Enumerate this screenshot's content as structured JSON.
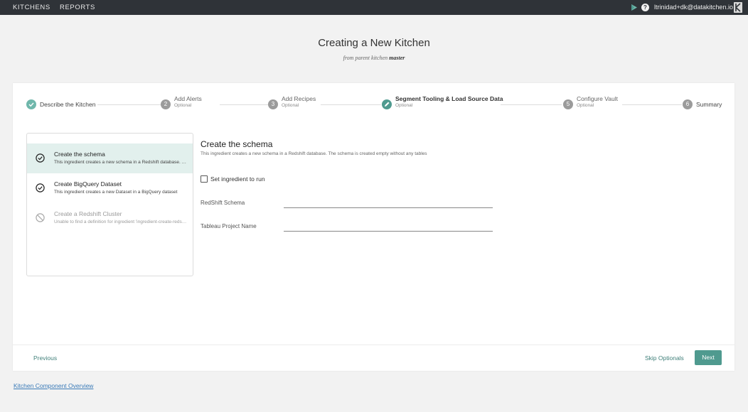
{
  "topbar": {
    "nav_kitchens": "KITCHENS",
    "nav_reports": "REPORTS",
    "help_glyph": "?",
    "user_email": "ltrinidad+dk@datakitchen.io"
  },
  "page": {
    "title": "Creating a New Kitchen",
    "subtitle_prefix": "from parent kitchen",
    "parent_kitchen": "master"
  },
  "wizard": {
    "steps": [
      {
        "number": "",
        "label": "Describe the Kitchen",
        "optional": "",
        "state": "complete"
      },
      {
        "number": "2",
        "label": "Add Alerts",
        "optional": "Optional",
        "state": "pending"
      },
      {
        "number": "3",
        "label": "Add Recipes",
        "optional": "Optional",
        "state": "pending"
      },
      {
        "number": "",
        "label": "Segment Tooling & Load Source Data",
        "optional": "Optional",
        "state": "active"
      },
      {
        "number": "5",
        "label": "Configure Vault",
        "optional": "Optional",
        "state": "pending"
      },
      {
        "number": "6",
        "label": "Summary",
        "optional": "",
        "state": "pending"
      }
    ]
  },
  "ingredients": [
    {
      "title": "Create the schema",
      "desc": "This ingredient creates a new schema in a Redshift database. The schema is created empty without any tables",
      "status_icon": "check-circle-icon",
      "selected": true
    },
    {
      "title": "Create BigQuery Dataset",
      "desc": "This ingredient creates a new Dataset in a BigQuery dataset",
      "status_icon": "check-circle-icon",
      "selected": false
    },
    {
      "title": "Create a Redshift Cluster",
      "desc": "Unable to find a definition for ingredient 'ingredient-create-redshift-cluster'",
      "status_icon": "blocked-icon",
      "selected": false
    }
  ],
  "detail": {
    "title": "Create the schema",
    "description": "This ingredient creates a new schema in a Redshift database. The schema is created empty without any tables",
    "checkbox_label": "Set ingredient to run",
    "fields": [
      {
        "label": "RedShift Schema",
        "value": ""
      },
      {
        "label": "Tableau Project Name",
        "value": ""
      }
    ]
  },
  "footer": {
    "previous": "Previous",
    "skip_optionals": "Skip Optionals",
    "next": "Next"
  },
  "links": {
    "overview": "Kitchen Component Overview"
  },
  "colors": {
    "topbar_bg": "#2f3338",
    "accent": "#4f9a8f",
    "active_row_bg": "#e2f0ed",
    "link": "#3b7bb8"
  }
}
